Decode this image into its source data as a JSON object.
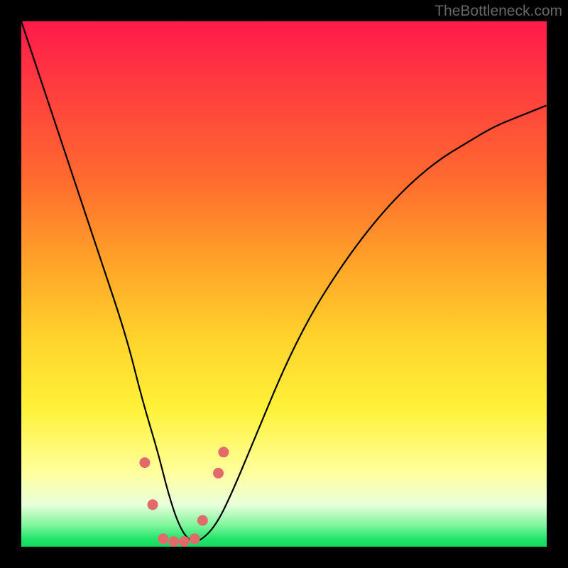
{
  "attribution": "TheBottleneck.com",
  "chart_data": {
    "type": "line",
    "title": "",
    "xlabel": "",
    "ylabel": "",
    "ylim": [
      0,
      100
    ],
    "x": [
      0,
      5,
      10,
      15,
      20,
      23,
      26,
      28,
      30,
      32,
      34,
      37,
      40,
      45,
      50,
      55,
      60,
      65,
      70,
      75,
      80,
      85,
      90,
      95,
      100
    ],
    "values": [
      100,
      85,
      70,
      55,
      40,
      28,
      18,
      10,
      4,
      1,
      1,
      4,
      10,
      22,
      34,
      44,
      52,
      59,
      65,
      70,
      74,
      77,
      80,
      82,
      84
    ],
    "annotations": {
      "dots_x": [
        23.5,
        25,
        27,
        29,
        31,
        33,
        34.5,
        37.5,
        38.5
      ],
      "dots_y": [
        16,
        8,
        1.5,
        1,
        1,
        1.5,
        5,
        14,
        18
      ]
    },
    "gradient_stops": [
      {
        "pos": 0,
        "color": "#ff1a4b"
      },
      {
        "pos": 50,
        "color": "#ffc82b"
      },
      {
        "pos": 85,
        "color": "#feff9e"
      },
      {
        "pos": 100,
        "color": "#14d95f"
      }
    ]
  }
}
